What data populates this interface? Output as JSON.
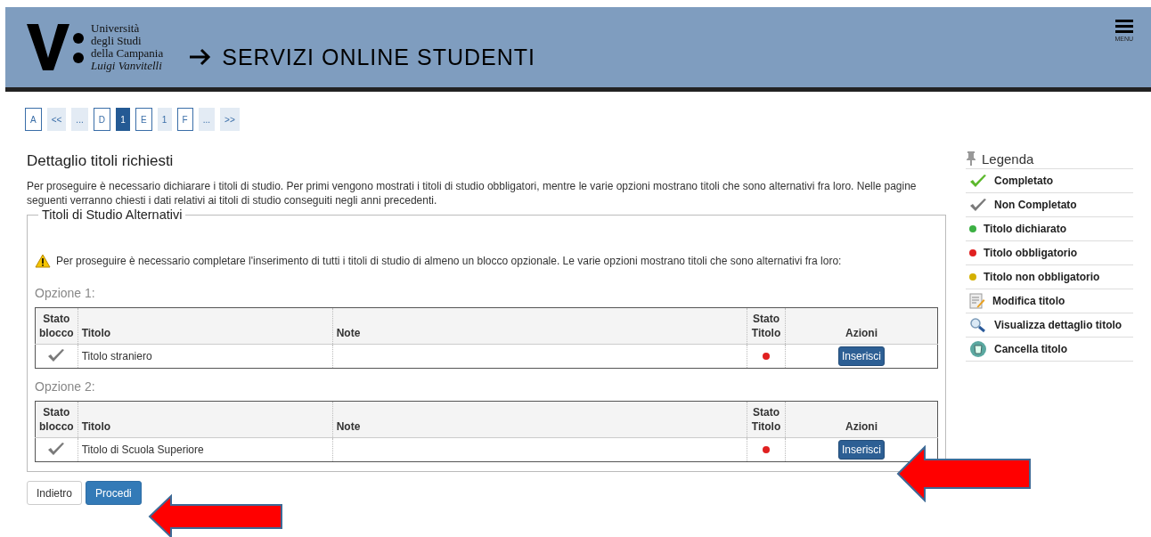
{
  "header": {
    "logo_lines": [
      "Università",
      "degli Studi",
      "della Campania",
      "Luigi Vanvitelli"
    ],
    "title": "SERVIZI ONLINE STUDENTI",
    "menu_label": "MENU"
  },
  "pagination": [
    {
      "label": "A",
      "kind": "step",
      "selected": false
    },
    {
      "label": "<<",
      "kind": "nav",
      "selected": false
    },
    {
      "label": "...",
      "kind": "nav",
      "selected": false
    },
    {
      "label": "D",
      "kind": "step",
      "selected": false
    },
    {
      "label": "1",
      "kind": "nav",
      "selected": true
    },
    {
      "label": "E",
      "kind": "step",
      "selected": false
    },
    {
      "label": "1",
      "kind": "nav",
      "selected": false
    },
    {
      "label": "F",
      "kind": "step",
      "selected": false
    },
    {
      "label": "...",
      "kind": "nav",
      "selected": false
    },
    {
      "label": ">>",
      "kind": "nav",
      "selected": false
    }
  ],
  "page_title": "Dettaglio titoli richiesti",
  "intro": "Per proseguire è necessario dichiarare i titoli di studio. Per primi vengono mostrati i titoli di studio obbligatori, mentre le varie opzioni mostrano titoli che sono alternativi fra loro. Nelle pagine seguenti verranno chiesti i dati relativi ai titoli di studio conseguiti negli anni precedenti.",
  "fieldset": {
    "legend": "Titoli di Studio Alternativi",
    "warning": "Per proseguire è necessario completare l'inserimento di tutti i titoli di studio di almeno un blocco opzionale. Le varie opzioni mostrano titoli che sono alternativi fra loro:",
    "options": [
      {
        "label": "Opzione 1:",
        "columns": [
          "Stato blocco",
          "Titolo",
          "Note",
          "Stato Titolo",
          "Azioni"
        ],
        "rows": [
          {
            "completed": false,
            "title": "Titolo straniero",
            "color": "#e02020",
            "action": "Inserisci"
          }
        ]
      },
      {
        "label": "Opzione 2:",
        "columns": [
          "Stato blocco",
          "Titolo",
          "Note",
          "Stato Titolo",
          "Azioni"
        ],
        "rows": [
          {
            "completed": false,
            "title": "Titolo di Scuola Superiore",
            "color": "#e02020",
            "action": "Inserisci"
          }
        ]
      }
    ]
  },
  "buttons": [
    {
      "label": "Indietro",
      "kind": "default"
    },
    {
      "label": "Procedi",
      "kind": "primary"
    }
  ],
  "legend": {
    "title": "Legenda",
    "items": [
      {
        "kind": "check",
        "completed": true,
        "label": "Completato"
      },
      {
        "kind": "check",
        "completed": false,
        "label": "Non Completato"
      },
      {
        "kind": "dot",
        "color": "#3cb043",
        "label": "Titolo dichiarato"
      },
      {
        "kind": "dot",
        "color": "#e02020",
        "label": "Titolo obbligatorio"
      },
      {
        "kind": "dot",
        "color": "#d4b000",
        "label": "Titolo non obbligatorio"
      },
      {
        "kind": "edit",
        "label": "Modifica titolo"
      },
      {
        "kind": "search",
        "label": "Visualizza dettaglio titolo"
      },
      {
        "kind": "delete",
        "label": "Cancella titolo"
      }
    ]
  }
}
